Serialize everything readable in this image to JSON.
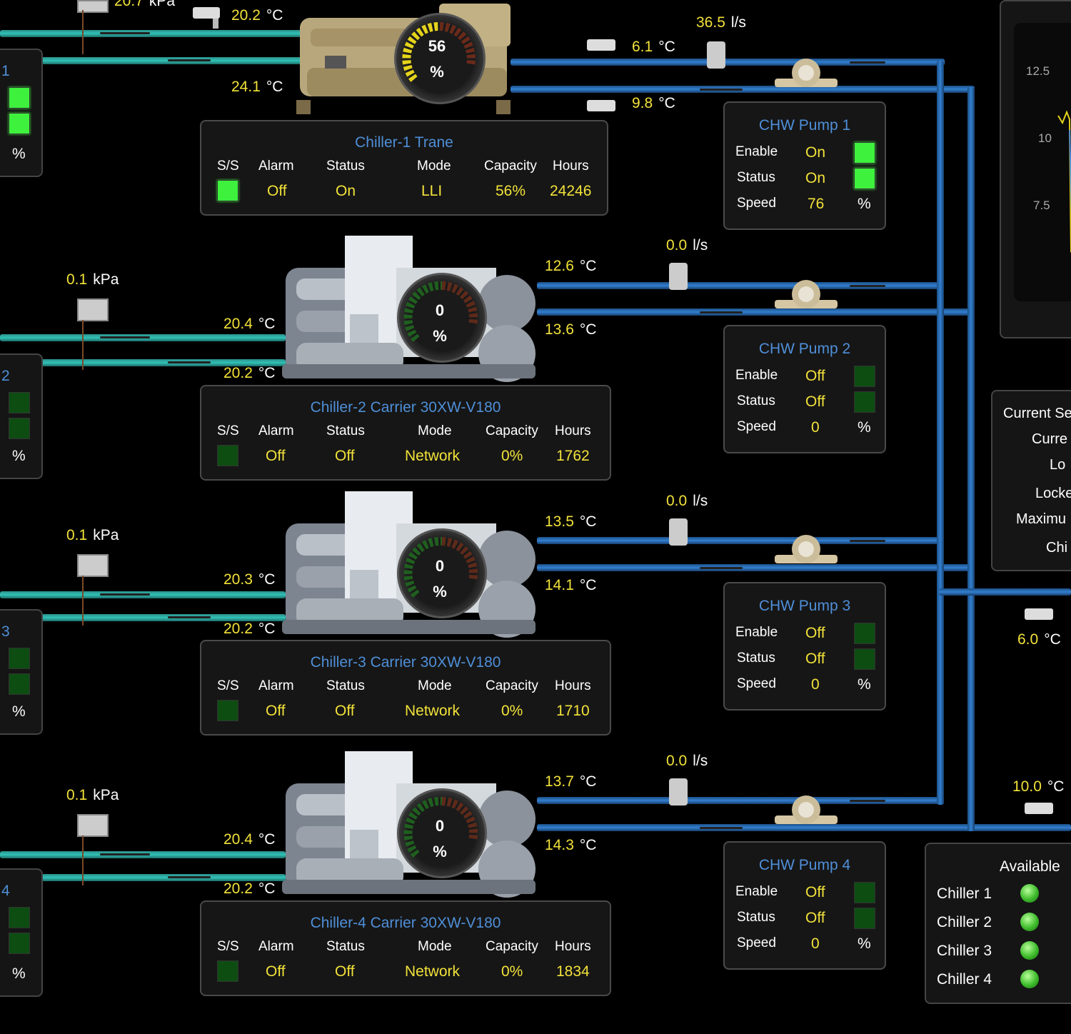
{
  "top": {
    "pressure": "20.7",
    "pressure_unit": "kPa",
    "temp_in": "20.2",
    "temp_out": "24.1",
    "unit_c": "°C",
    "flow": "36.5",
    "flow_unit": "l/s",
    "sup_temp": "6.1",
    "ret_temp": "9.8",
    "gauge_value": "56",
    "gauge_unit": "%"
  },
  "chillers": [
    {
      "title": "Chiller-1 Trane",
      "ss": "on",
      "alarm": "Off",
      "status": "On",
      "mode": "LLI",
      "capacity": "56%",
      "hours": "24246",
      "side_num": "1",
      "side_pct": "%"
    },
    {
      "title": "Chiller-2 Carrier 30XW-V180",
      "ss": "off",
      "alarm": "Off",
      "status": "Off",
      "mode": "Network",
      "capacity": "0%",
      "hours": "1762",
      "pressure": "0.1",
      "t_in": "20.4",
      "t_out": "20.2",
      "sup": "12.6",
      "ret": "13.6",
      "flow": "0.0",
      "gauge": "0",
      "side_num": "2",
      "side_pct": "%"
    },
    {
      "title": "Chiller-3 Carrier 30XW-V180",
      "ss": "off",
      "alarm": "Off",
      "status": "Off",
      "mode": "Network",
      "capacity": "0%",
      "hours": "1710",
      "pressure": "0.1",
      "t_in": "20.3",
      "t_out": "20.2",
      "sup": "13.5",
      "ret": "14.1",
      "flow": "0.0",
      "gauge": "0",
      "side_num": "3",
      "side_pct": "%"
    },
    {
      "title": "Chiller-4 Carrier 30XW-V180",
      "ss": "off",
      "alarm": "Off",
      "status": "Off",
      "mode": "Network",
      "capacity": "0%",
      "hours": "1834",
      "pressure": "0.1",
      "t_in": "20.4",
      "t_out": "20.2",
      "sup": "13.7",
      "ret": "14.3",
      "flow": "0.0",
      "gauge": "0",
      "side_num": "4",
      "side_pct": "%"
    }
  ],
  "headers": {
    "ss": "S/S",
    "alarm": "Alarm",
    "status": "Status",
    "mode": "Mode",
    "capacity": "Capacity",
    "hours": "Hours"
  },
  "pumps": [
    {
      "title": "CHW Pump 1",
      "enable": "On",
      "status": "On",
      "speed": "76",
      "pct": "%",
      "enable_led": "on",
      "status_led": "on"
    },
    {
      "title": "CHW Pump 2",
      "enable": "Off",
      "status": "Off",
      "speed": "0",
      "pct": "%",
      "enable_led": "off",
      "status_led": "off"
    },
    {
      "title": "CHW Pump 3",
      "enable": "Off",
      "status": "Off",
      "speed": "0",
      "pct": "%",
      "enable_led": "off",
      "status_led": "off"
    },
    {
      "title": "CHW Pump 4",
      "enable": "Off",
      "status": "Off",
      "speed": "0",
      "pct": "%",
      "enable_led": "off",
      "status_led": "off"
    }
  ],
  "pump_labels": {
    "enable": "Enable",
    "status": "Status",
    "speed": "Speed"
  },
  "trend": {
    "ticks": [
      "12.5",
      "10",
      "7.5"
    ]
  },
  "sequence_panel": {
    "lines": [
      "Current Se",
      "Curre",
      "Lo",
      "Locke",
      "Maximu",
      "Chi"
    ]
  },
  "right_temps": {
    "supply": "6.0",
    "return": "10.0",
    "unit": "°C"
  },
  "available": {
    "title": "Available",
    "items": [
      "Chiller 1",
      "Chiller 2",
      "Chiller 3",
      "Chiller 4"
    ]
  },
  "colors": {
    "teal": "#31c2b6",
    "blue": "#3380d1",
    "value_yellow": "#f2e23a",
    "title_blue": "#4f8fd8",
    "led_on": "#3df13d",
    "led_off": "#0d4d12"
  }
}
